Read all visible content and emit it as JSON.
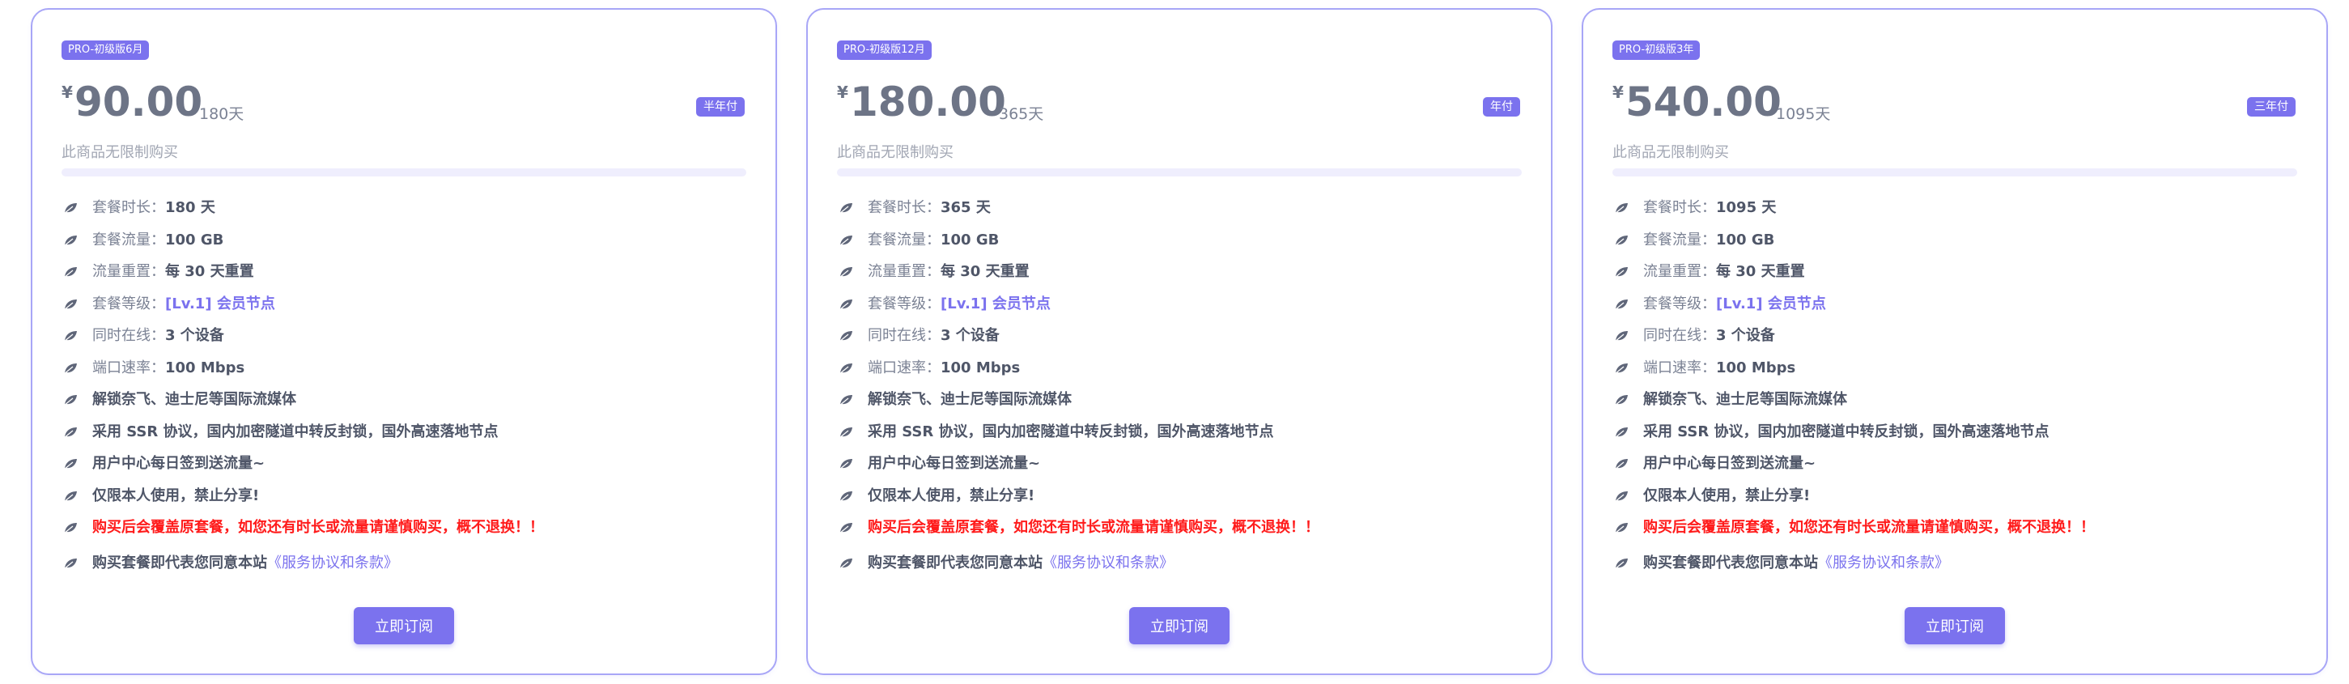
{
  "plans": [
    {
      "tag": "PRO-初级版6月",
      "currency": "¥",
      "price": "90.00",
      "days": "180天",
      "pay_label": "半年付",
      "limit": "此商品无限制购买",
      "features": {
        "duration_label": "套餐时长：",
        "duration_value": "180 天",
        "traffic_label": "套餐流量：",
        "traffic_value": "100 GB",
        "reset_label": "流量重置：",
        "reset_value": "每 30 天重置",
        "level_label": "套餐等级：",
        "level_value": "[Lv.1] 会员节点",
        "online_label": "同时在线：",
        "online_value": "3 个设备",
        "speed_label": "端口速率：",
        "speed_value": "100 Mbps",
        "unlock": "解锁奈飞、迪士尼等国际流媒体",
        "protocol": "采用 SSR 协议，国内加密隧道中转反封锁，国外高速落地节点",
        "checkin": "用户中心每日签到送流量~",
        "personal": "仅限本人使用，禁止分享!",
        "warning": "购买后会覆盖原套餐，如您还有时长或流量请谨慎购买，概不退换！！",
        "agree_prefix": "购买套餐即代表您同意本站",
        "agree_link": "《服务协议和条款》"
      },
      "button": "立即订阅"
    },
    {
      "tag": "PRO-初级版12月",
      "currency": "¥",
      "price": "180.00",
      "days": "365天",
      "pay_label": "年付",
      "limit": "此商品无限制购买",
      "features": {
        "duration_label": "套餐时长：",
        "duration_value": "365 天",
        "traffic_label": "套餐流量：",
        "traffic_value": "100 GB",
        "reset_label": "流量重置：",
        "reset_value": "每 30 天重置",
        "level_label": "套餐等级：",
        "level_value": "[Lv.1] 会员节点",
        "online_label": "同时在线：",
        "online_value": "3 个设备",
        "speed_label": "端口速率：",
        "speed_value": "100 Mbps",
        "unlock": "解锁奈飞、迪士尼等国际流媒体",
        "protocol": "采用 SSR 协议，国内加密隧道中转反封锁，国外高速落地节点",
        "checkin": "用户中心每日签到送流量~",
        "personal": "仅限本人使用，禁止分享!",
        "warning": "购买后会覆盖原套餐，如您还有时长或流量请谨慎购买，概不退换！！",
        "agree_prefix": "购买套餐即代表您同意本站",
        "agree_link": "《服务协议和条款》"
      },
      "button": "立即订阅"
    },
    {
      "tag": "PRO-初级版3年",
      "currency": "¥",
      "price": "540.00",
      "days": "1095天",
      "pay_label": "三年付",
      "limit": "此商品无限制购买",
      "features": {
        "duration_label": "套餐时长：",
        "duration_value": "1095 天",
        "traffic_label": "套餐流量：",
        "traffic_value": "100 GB",
        "reset_label": "流量重置：",
        "reset_value": "每 30 天重置",
        "level_label": "套餐等级：",
        "level_value": "[Lv.1] 会员节点",
        "online_label": "同时在线：",
        "online_value": "3 个设备",
        "speed_label": "端口速率：",
        "speed_value": "100 Mbps",
        "unlock": "解锁奈飞、迪士尼等国际流媒体",
        "protocol": "采用 SSR 协议，国内加密隧道中转反封锁，国外高速落地节点",
        "checkin": "用户中心每日签到送流量~",
        "personal": "仅限本人使用，禁止分享!",
        "warning": "购买后会覆盖原套餐，如您还有时长或流量请谨慎购买，概不退换！！",
        "agree_prefix": "购买套餐即代表您同意本站",
        "agree_link": "《服务协议和条款》"
      },
      "button": "立即订阅"
    }
  ],
  "icons": {
    "feature": "leaf-icon"
  },
  "colors": {
    "accent": "#7b72ee",
    "warning": "#ff1b1b",
    "border": "#a8a6f7"
  }
}
